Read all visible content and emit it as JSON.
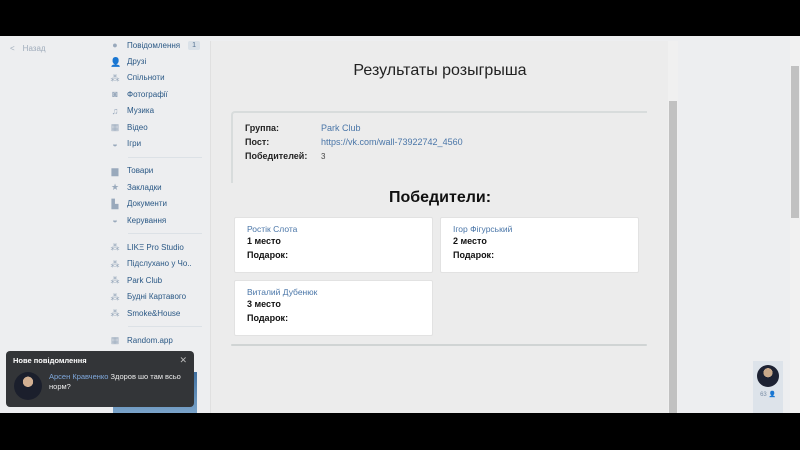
{
  "nav": {
    "back": "Назад",
    "items": [
      {
        "icon": "chat-icon",
        "label": "Повідомлення",
        "badge": "1"
      },
      {
        "icon": "user-icon",
        "label": "Друзі"
      },
      {
        "icon": "group-icon",
        "label": "Спільноти"
      },
      {
        "icon": "camera-icon",
        "label": "Фотографії"
      },
      {
        "icon": "music-icon",
        "label": "Музика"
      },
      {
        "icon": "video-icon",
        "label": "Відео"
      },
      {
        "icon": "gamepad-icon",
        "label": "Ігри"
      }
    ],
    "items2": [
      {
        "icon": "bag-icon",
        "label": "Товари"
      },
      {
        "icon": "star-icon",
        "label": "Закладки"
      },
      {
        "icon": "document-icon",
        "label": "Документи"
      },
      {
        "icon": "gamepad-icon",
        "label": "Керування"
      }
    ],
    "groups": [
      "LIKΞ Pro Studio",
      "Підслухано у Чо..",
      "Park Club",
      "Будні Картавого",
      "Smoke&House"
    ],
    "apps": [
      "Random.app"
    ]
  },
  "app": {
    "title": "Результаты розыгрыша",
    "info": {
      "group_label": "Группа:",
      "group_value": "Park Club",
      "post_label": "Пост:",
      "post_value": "https://vk.com/wall-73922742_4560",
      "winners_label": "Победителей:",
      "winners_value": "3"
    },
    "winners_title": "Победители:",
    "winners": [
      {
        "name": "Ростік Слота",
        "place": "1 место",
        "gift": "Подарок:"
      },
      {
        "name": "Ігор Фігурський",
        "place": "2 место",
        "gift": "Подарок:"
      },
      {
        "name": "Виталий Дубенюк",
        "place": "3 место",
        "gift": "Подарок:"
      }
    ]
  },
  "toast": {
    "title": "Нове повідомлення",
    "sender": "Арсен Кравченко",
    "text": "Здоров шо там всьо норм?"
  },
  "chat": {
    "count": "63"
  }
}
